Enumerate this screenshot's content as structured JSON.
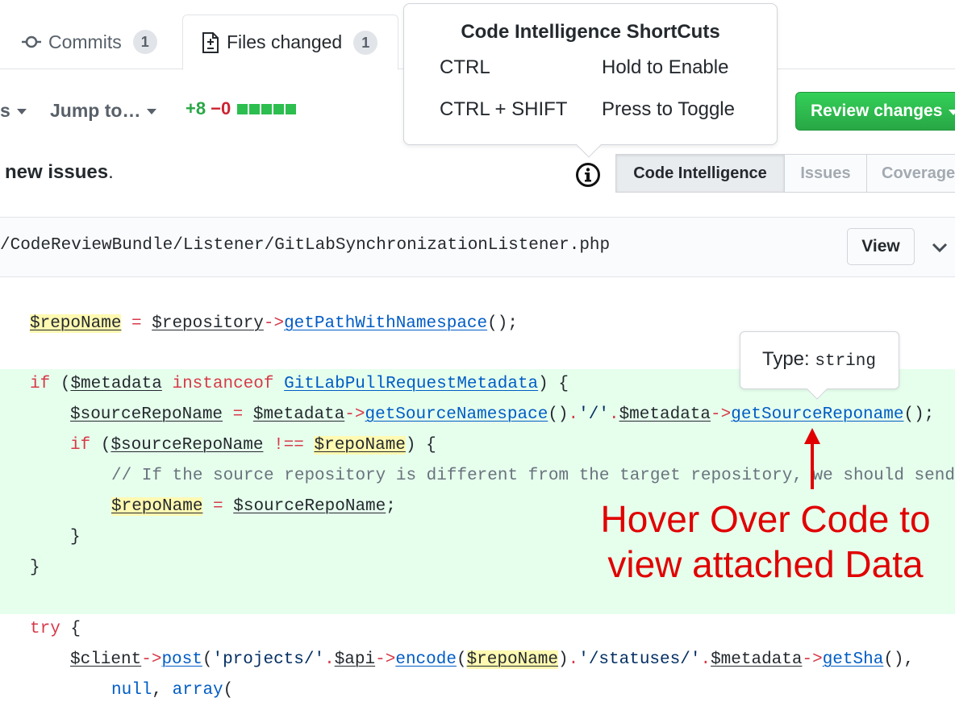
{
  "tabs": {
    "commits_label": "Commits",
    "commits_count": "1",
    "files_label": "Files changed",
    "files_count": "1"
  },
  "toolbar": {
    "partial_label": "s",
    "jump_label": "Jump to…",
    "additions": "+8",
    "deletions": "−0",
    "review_label": "Review changes"
  },
  "popover": {
    "title": "Code Intelligence ShortCuts",
    "rows": [
      {
        "key": "CTRL",
        "value": "Hold to Enable"
      },
      {
        "key": "CTRL + SHIFT",
        "value": "Press to Toggle"
      }
    ]
  },
  "status": {
    "text_bold": "new issues",
    "text_tail": "."
  },
  "segments": [
    "Code Intelligence",
    "Issues",
    "Coverage"
  ],
  "file": {
    "path": "/CodeReviewBundle/Listener/GitLabSynchronizationListener.php",
    "view_label": "View"
  },
  "code": {
    "l1": {
      "v1": "$repoName",
      "op": " = ",
      "v2": "$repository",
      "arrow": "->",
      "fn": "getPathWithNamespace",
      "tail": "();"
    },
    "l2": {
      "kw": "if",
      "p1": " (",
      "v1": "$metadata",
      "kw2": " instanceof ",
      "fn": "GitLabPullRequestMetadata",
      "tail": ") {"
    },
    "l3": {
      "v1": "$sourceRepoName",
      "op": " = ",
      "v2": "$metadata",
      "a1": "->",
      "fn1": "getSourceNamespace",
      "s1": "()",
      "dot1": ".",
      "str": "'/'",
      "dot2": ".",
      "v3": "$metadata",
      "a2": "->",
      "fn2": "getSourceReponame",
      "tail": "();"
    },
    "l4": {
      "kw": "if",
      "p1": " (",
      "v1": "$sourceRepoName",
      "op": " !== ",
      "v2": "$repoName",
      "tail": ") {"
    },
    "l5": {
      "comment": "// If the source repository is different from the target repository, we should send"
    },
    "l6": {
      "v1": "$repoName",
      "op": " = ",
      "v2": "$sourceRepoName",
      "tail": ";"
    },
    "l7": "}",
    "l8": "}",
    "l9": {
      "kw": "try",
      "tail": " {"
    },
    "l10": {
      "v1": "$client",
      "a1": "->",
      "fn1": "post",
      "p1": "(",
      "str1": "'projects/'",
      "dot1": ".",
      "v2": "$api",
      "a2": "->",
      "fn2": "encode",
      "p2": "(",
      "v3": "$repoName",
      "p3": ")",
      "dot2": ".",
      "str2": "'/statuses/'",
      "dot3": ".",
      "v4": "$metadata",
      "a3": "->",
      "fn3": "getSha",
      "tail": "(),"
    },
    "l11": {
      "k1": "null",
      "c": ", ",
      "k2": "array",
      "tail": "("
    }
  },
  "type_tooltip": {
    "label": "Type:",
    "value": "string"
  },
  "annotation": {
    "line1": "Hover Over Code to",
    "line2": "view attached Data",
    "color": "#e00000"
  },
  "colors": {
    "added_bg": "#e6ffed",
    "highlight": "#fff9b1",
    "review_green": "#2ea44f",
    "keyword_red": "#d73a49",
    "function_blue": "#005cc5"
  },
  "icons": [
    "commit-icon",
    "file-diff-icon",
    "info-icon",
    "chevron-down-icon",
    "annotation-arrow-icon"
  ]
}
